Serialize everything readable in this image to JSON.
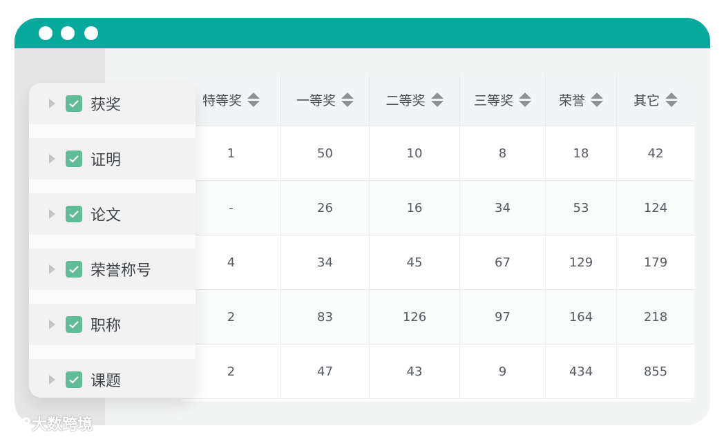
{
  "columns": [
    "特等奖",
    "一等奖",
    "二等奖",
    "三等奖",
    "荣誉",
    "其它"
  ],
  "rows": [
    [
      "1",
      "50",
      "10",
      "8",
      "18",
      "42"
    ],
    [
      "-",
      "26",
      "16",
      "34",
      "53",
      "124"
    ],
    [
      "4",
      "34",
      "45",
      "67",
      "129",
      "179"
    ],
    [
      "2",
      "83",
      "126",
      "97",
      "164",
      "218"
    ],
    [
      "2",
      "47",
      "43",
      "9",
      "434",
      "855"
    ]
  ],
  "categories": [
    {
      "label": "获奖",
      "checked": true
    },
    {
      "label": "证明",
      "checked": true
    },
    {
      "label": "论文",
      "checked": true
    },
    {
      "label": "荣誉称号",
      "checked": true
    },
    {
      "label": "职称",
      "checked": true
    },
    {
      "label": "课题",
      "checked": true
    }
  ],
  "watermark": "大数跨境",
  "colors": {
    "titlebar": "#07a99c",
    "checkbox": "#5fbc97"
  }
}
